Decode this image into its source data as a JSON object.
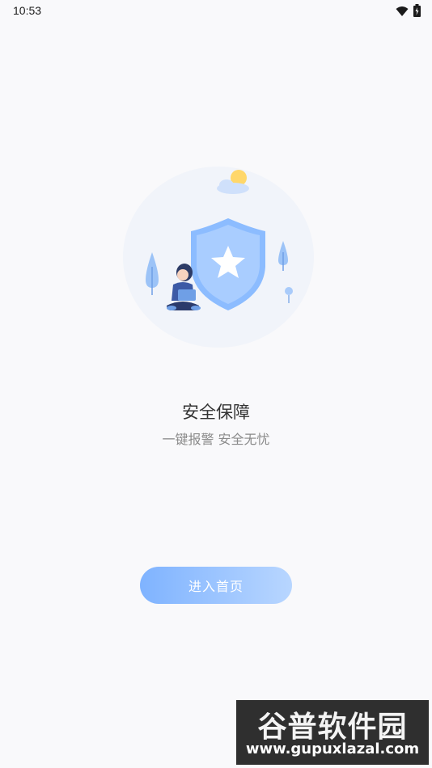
{
  "status_bar": {
    "time": "10:53",
    "icons": [
      "wifi-icon",
      "battery-icon"
    ]
  },
  "main": {
    "title": "安全保障",
    "subtitle": "一键报警 安全无忧",
    "enter_button_label": "进入首页"
  },
  "watermark": {
    "logo_text": "谷普软件园",
    "url": "www.gupuxlazal.com"
  },
  "colors": {
    "accent": "#7fb3ff",
    "shield": "#8cbcff",
    "sun": "#ffd76a",
    "background": "#f9f9fb"
  }
}
